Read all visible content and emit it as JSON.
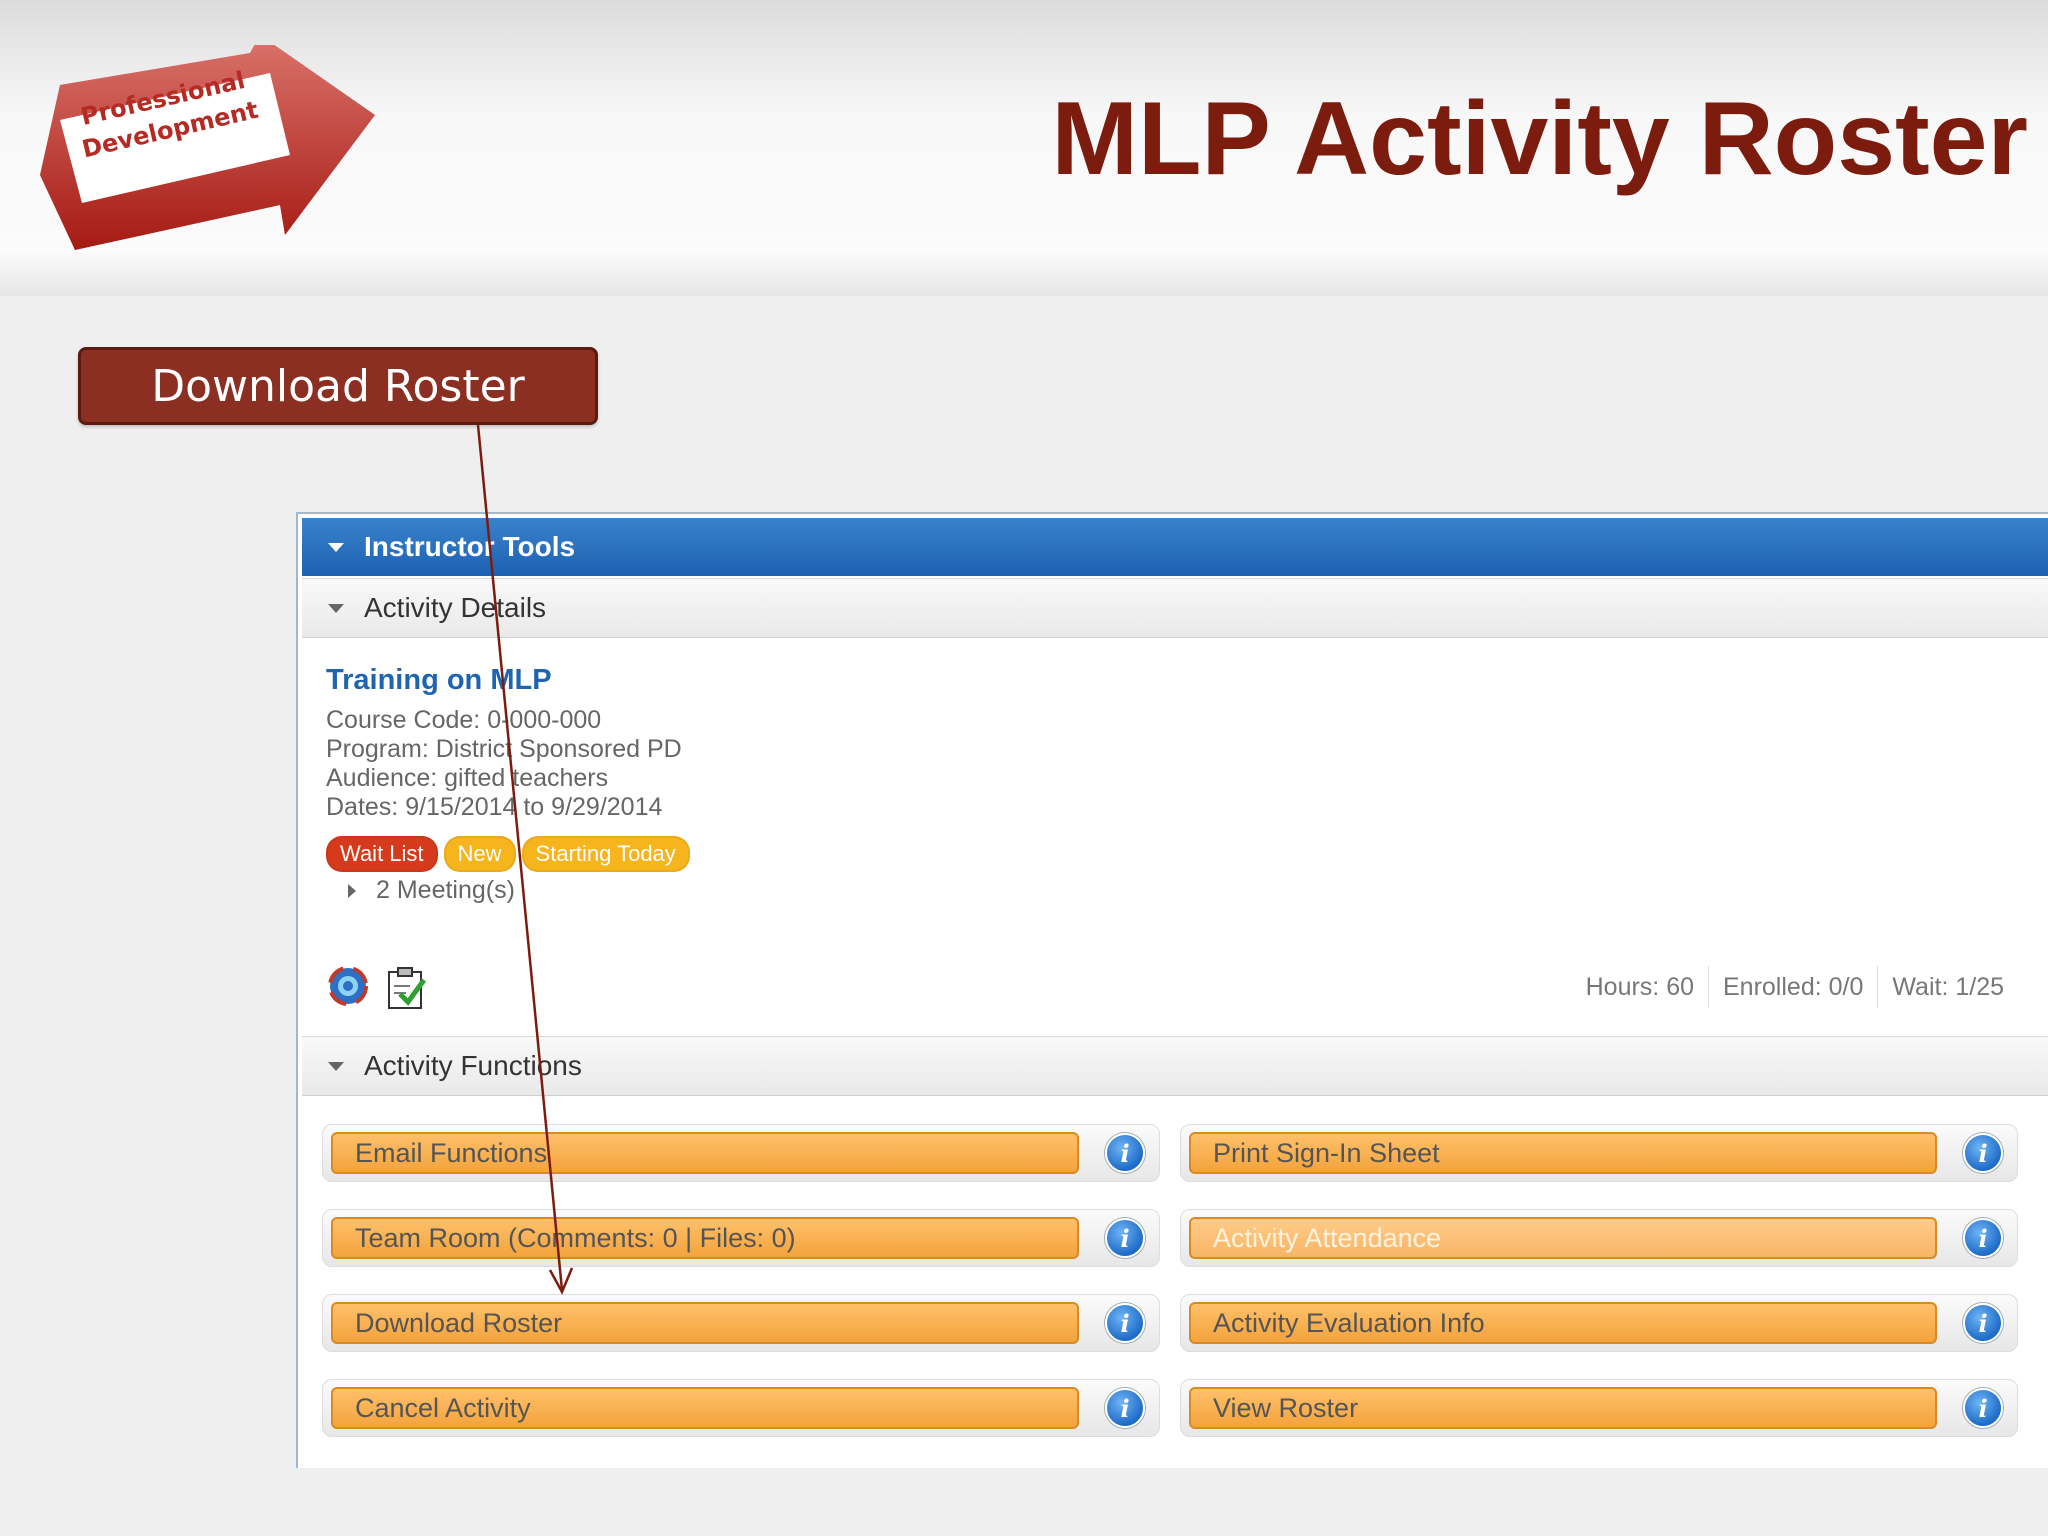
{
  "slide": {
    "title": "MLP Activity Roster",
    "logo_line1": "Professional",
    "logo_line2": "Development",
    "callout_label": "Download Roster"
  },
  "instructor_tools": {
    "header": "Instructor Tools",
    "activity_details": {
      "header": "Activity Details",
      "course_title": "Training on MLP",
      "course_code": "Course Code: 0-000-000",
      "program": "Program: District Sponsored PD",
      "audience": "Audience: gifted teachers",
      "dates": "Dates: 9/15/2014 to 9/29/2014",
      "badges": [
        "Wait List",
        "New",
        "Starting Today"
      ],
      "meetings": "2 Meeting(s)",
      "stats": {
        "hours": "Hours: 60",
        "enrolled": "Enrolled: 0/0",
        "wait": "Wait: 1/25"
      }
    },
    "activity_functions": {
      "header": "Activity Functions",
      "left": [
        "Email Functions",
        "Team Room (Comments: 0 | Files: 0)",
        "Download Roster",
        "Cancel Activity"
      ],
      "right": [
        "Print Sign-In Sheet",
        "Activity Attendance",
        "Activity Evaluation Info",
        "View Roster"
      ],
      "info_glyph": "i"
    }
  },
  "colors": {
    "title": "#7b1c0f",
    "callout": "#8b2f22",
    "panel_header": "#1c61b2",
    "function_button": "#f3a33c",
    "badge_red": "#d63a1c",
    "badge_yellow": "#f6b41d"
  }
}
